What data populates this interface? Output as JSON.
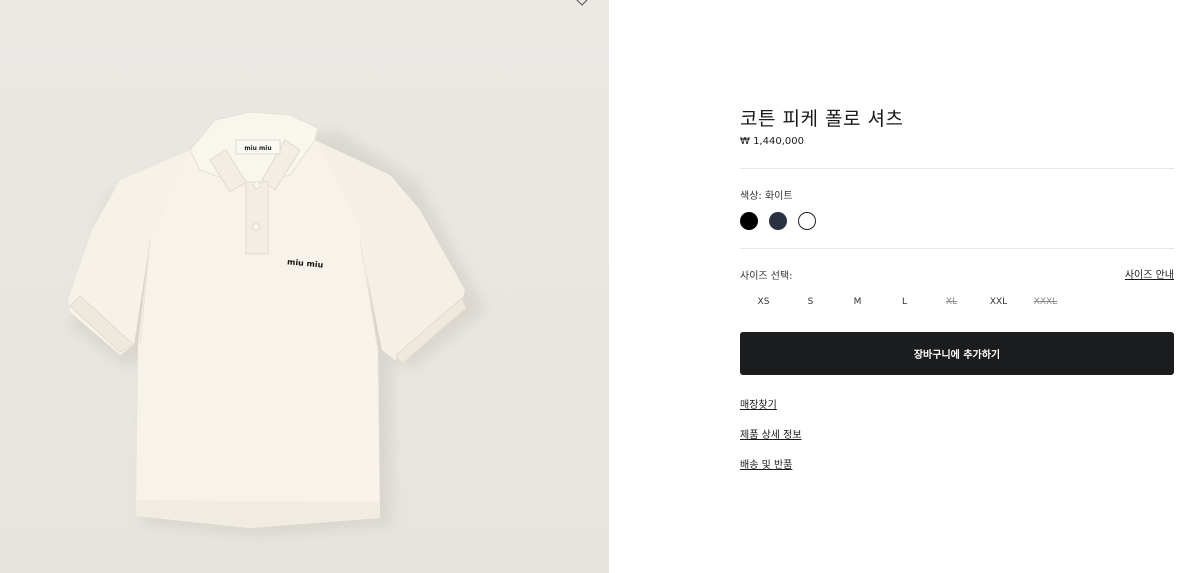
{
  "product": {
    "title": "코튼 피케 폴로 셔츠",
    "price": "₩ 1,440,000",
    "image_logo": "miu miu",
    "colors": {
      "label": "색상: 화이트",
      "options": [
        {
          "name": "black",
          "hex": "#000000"
        },
        {
          "name": "navy",
          "hex": "#2a3142"
        },
        {
          "name": "white",
          "hex": "#ffffff",
          "selected": true
        }
      ]
    },
    "sizes": {
      "label": "사이즈 선택:",
      "guide_link": "사이즈 안내",
      "options": [
        {
          "label": "XS",
          "available": true
        },
        {
          "label": "S",
          "available": true
        },
        {
          "label": "M",
          "available": true
        },
        {
          "label": "L",
          "available": true
        },
        {
          "label": "XL",
          "available": false
        },
        {
          "label": "XXL",
          "available": true
        },
        {
          "label": "XXXL",
          "available": false
        }
      ]
    },
    "add_to_cart": "장바구니에 추가하기",
    "links": [
      "매장찾기",
      "제품 상세 정보",
      "배송 및 반품"
    ]
  }
}
